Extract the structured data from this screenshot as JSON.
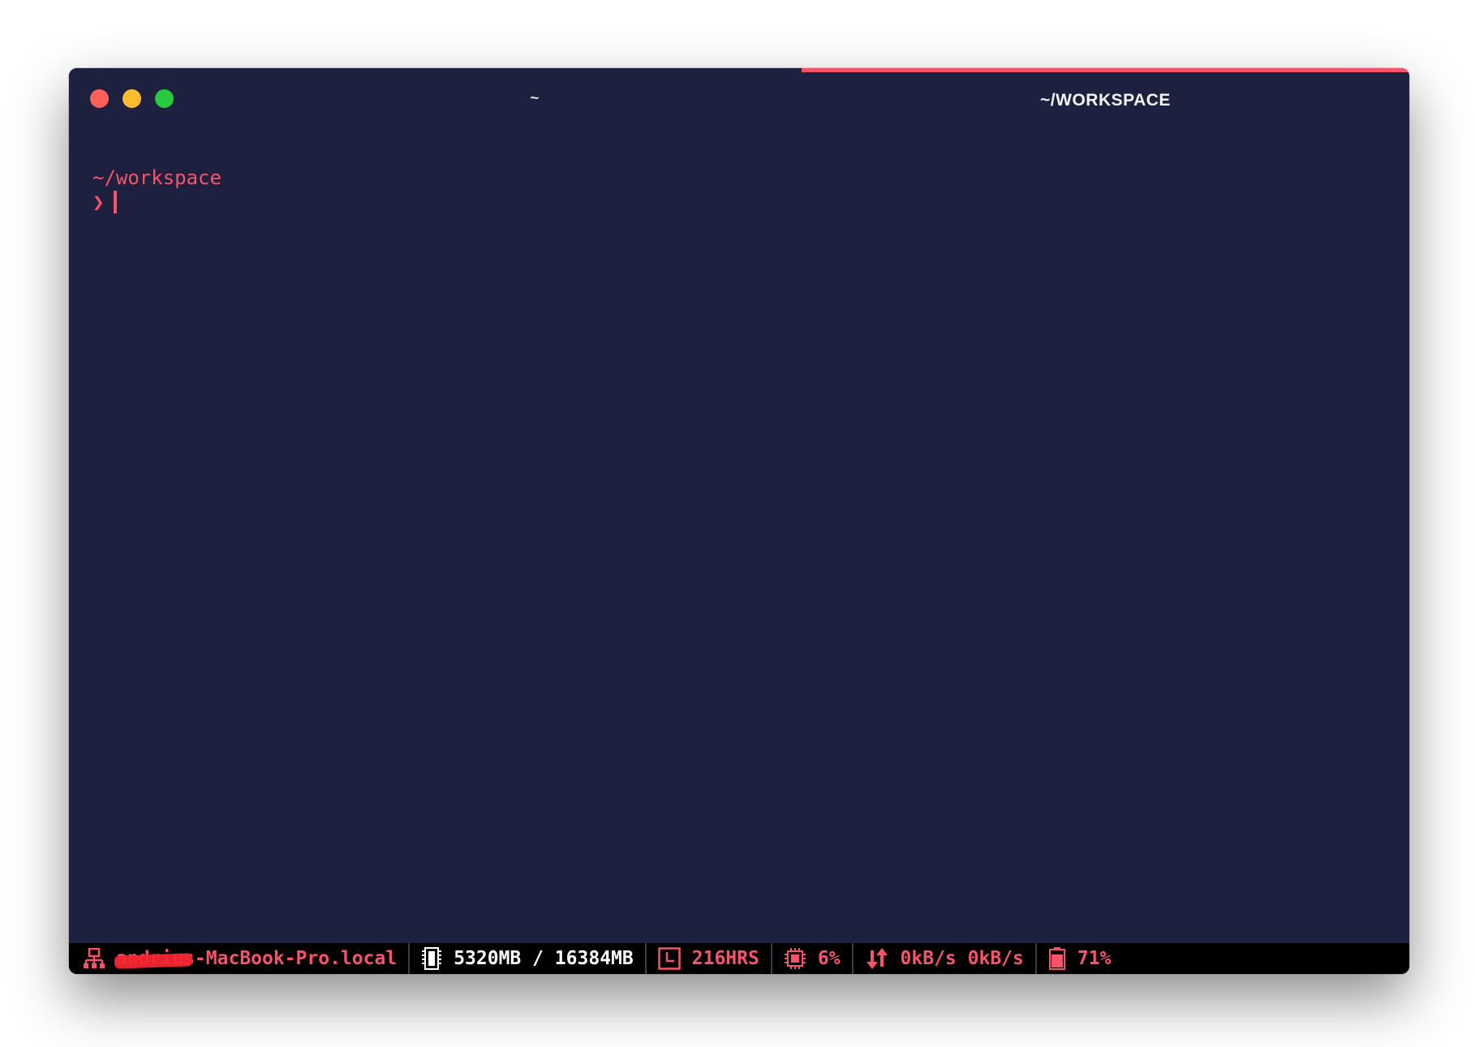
{
  "window": {
    "tabs": [
      {
        "label": "~",
        "active": false
      },
      {
        "label": "~/WORKSPACE",
        "active": true
      }
    ]
  },
  "terminal": {
    "cwd": "~/workspace",
    "prompt_symbol": "❯"
  },
  "statusbar": {
    "hostname": "andrius-MacBook-Pro.local",
    "memory": "5320MB / 16384MB",
    "uptime": "216HRS",
    "cpu": "6%",
    "network": "0kB/s 0kB/s",
    "battery": "71%"
  },
  "colors": {
    "background": "#1e2040",
    "accent": "#f9536b",
    "statusbar_bg": "#000000"
  }
}
